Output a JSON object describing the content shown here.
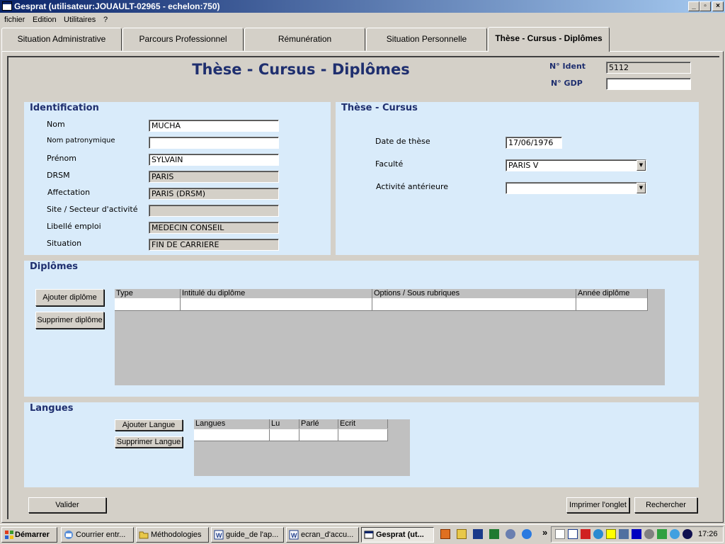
{
  "window": {
    "title": "Gesprat (utilisateur:JOUAULT-02965 - echelon:750)",
    "min": "_",
    "max": "▫",
    "close": "×"
  },
  "menu": [
    "fichier",
    "Edition",
    "Utilitaires",
    "?"
  ],
  "tabs": [
    "Situation Administrative",
    "Parcours Professionnel",
    "Rémunération",
    "Situation Personnelle",
    "Thèse - Cursus - Diplômes"
  ],
  "page_title": "Thèse - Cursus - Diplômes",
  "ident": {
    "label": "N° Ident",
    "value": "5112",
    "gdp_label": "N° GDP",
    "gdp_value": ""
  },
  "identification": {
    "title": "Identification",
    "fields": [
      {
        "label": "Nom",
        "value": "MUCHA"
      },
      {
        "label": "Nom patronymique",
        "value": ""
      },
      {
        "label": "Prénom",
        "value": "SYLVAIN"
      },
      {
        "label": "DRSM",
        "value": "PARIS"
      },
      {
        "label": "Affectation",
        "value": "PARIS (DRSM)"
      },
      {
        "label": "Site / Secteur d'activité",
        "value": ""
      },
      {
        "label": "Libellé emploi",
        "value": "MEDECIN CONSEIL"
      },
      {
        "label": "Situation",
        "value": "FIN DE CARRIERE"
      }
    ]
  },
  "these": {
    "title": "Thèse - Cursus",
    "date_label": "Date de thèse",
    "date_value": "17/06/1976",
    "faculte_label": "Faculté",
    "faculte_value": "PARIS V",
    "activite_label": "Activité antérieure",
    "activite_value": ""
  },
  "diplomes": {
    "title": "Diplômes",
    "add_label": "Ajouter diplôme",
    "remove_label": "Supprimer diplôme",
    "columns": [
      "Type",
      "Intitulé du diplôme",
      "Options / Sous rubriques",
      "Année diplôme"
    ]
  },
  "langues": {
    "title": "Langues",
    "add_label": "Ajouter Langue",
    "remove_label": "Supprimer Langue",
    "columns": [
      "Langues",
      "Lu",
      "Parlé",
      "Ecrit"
    ]
  },
  "actions": {
    "valider": "Valider",
    "imprimer": "Imprimer l'onglet",
    "rechercher": "Rechercher"
  },
  "taskbar": {
    "start": "Démarrer",
    "tasks": [
      "Courrier entr...",
      "Méthodologies",
      "guide_de l'ap...",
      "ecran_d'accu...",
      "Gesprat (ut..."
    ],
    "more": "»",
    "clock": "17:26"
  }
}
